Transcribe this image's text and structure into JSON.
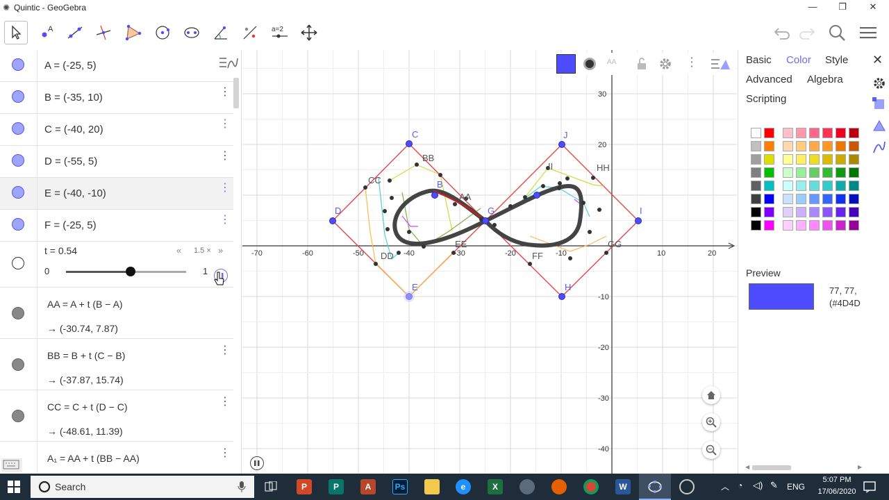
{
  "window": {
    "title": "Quintic - GeoGebra"
  },
  "algebra": {
    "points": [
      {
        "label": "A = (-25, 5)"
      },
      {
        "label": "B = (-35, 10)"
      },
      {
        "label": "C = (-40, 20)"
      },
      {
        "label": "D = (-55, 5)"
      },
      {
        "label": "E = (-40, -10)"
      },
      {
        "label": "F = (-25, 5)"
      }
    ],
    "slider": {
      "label": "t = 0.54",
      "min": "0",
      "max": "1",
      "value": 0.54,
      "speed": "1.5 ×"
    },
    "defs": [
      {
        "formula": "AA = A + t (B − A)",
        "result": "→  (-30.74, 7.87)"
      },
      {
        "formula": "BB = B + t (C − B)",
        "result": "→  (-37.87, 15.74)"
      },
      {
        "formula": "CC = C + t (D − C)",
        "result": "→  (-48.61, 11.39)"
      },
      {
        "formula": "A₁ = AA + t (BB − AA)",
        "result": ""
      }
    ]
  },
  "graph": {
    "x_ticks": [
      "-70",
      "-60",
      "-50",
      "-40",
      "-30",
      "-20",
      "-10",
      "10",
      "20"
    ],
    "y_ticks": [
      "30",
      "20",
      "-10",
      "-20",
      "-30",
      "-40"
    ],
    "point_labels": {
      "C": "C",
      "J": "J",
      "D": "D",
      "I": "I",
      "E": "E",
      "H": "H",
      "G": "G",
      "B": "B",
      "AA": "AA",
      "BB": "BB",
      "CC": "CC",
      "DD": "DD",
      "EE": "EE",
      "FF": "FF",
      "GG": "GG",
      "HH": "HH",
      "II": "II"
    }
  },
  "properties": {
    "tabs": [
      "Basic",
      "Color",
      "Style",
      "Advanced",
      "Algebra",
      "Scripting"
    ],
    "active_tab": "Color",
    "preview_label": "Preview",
    "preview_color": "#4D4DFF",
    "rgb_text": "77, 77,",
    "hex_text": "(#4D4D"
  },
  "colors": {
    "accent": "#6a6fe6",
    "curve": "#444444",
    "polygon": "#e8454a",
    "point": "#4d4dff"
  },
  "taskbar": {
    "search_placeholder": "Search",
    "lang": "ENG",
    "time": "5:07 PM",
    "date": "17/06/2020"
  }
}
